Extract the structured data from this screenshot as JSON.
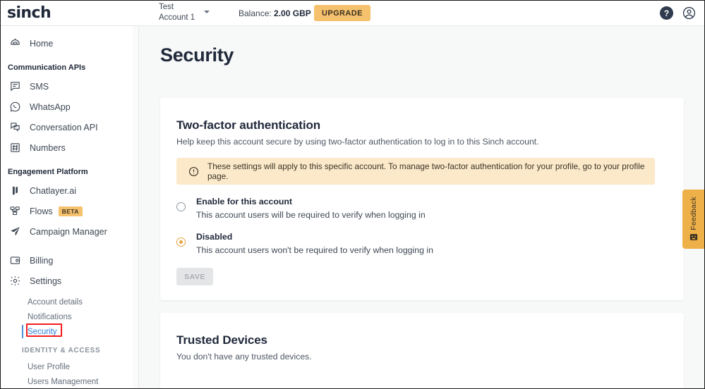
{
  "topbar": {
    "logo": "sinch",
    "account_name": "Test Account 1",
    "account_caret_icon": "chevron-down-icon",
    "balance_label": "Balance:",
    "balance_value": "2.00 GBP",
    "upgrade_label": "UPGRADE",
    "help_icon": "?",
    "help_icon_name": "help-circle-icon",
    "user_icon_name": "account-circle-icon"
  },
  "sidebar": {
    "home": {
      "label": "Home",
      "icon": "home-icon"
    },
    "groups": [
      {
        "title": "Communication APIs",
        "items": [
          {
            "label": "SMS",
            "icon": "sms-icon"
          },
          {
            "label": "WhatsApp",
            "icon": "whatsapp-icon"
          },
          {
            "label": "Conversation API",
            "icon": "conversation-icon"
          },
          {
            "label": "Numbers",
            "icon": "numbers-icon"
          }
        ]
      },
      {
        "title": "Engagement Platform",
        "items": [
          {
            "label": "Chatlayer.ai",
            "icon": "chatlayer-icon"
          },
          {
            "label": "Flows",
            "icon": "flows-icon",
            "badge": "BETA"
          },
          {
            "label": "Campaign Manager",
            "icon": "campaign-icon"
          }
        ]
      }
    ],
    "bottom_items": [
      {
        "label": "Billing",
        "icon": "billing-icon"
      },
      {
        "label": "Settings",
        "icon": "settings-gear-icon"
      }
    ],
    "settings_subitems": [
      {
        "label": "Account details",
        "active": false
      },
      {
        "label": "Notifications",
        "active": false
      },
      {
        "label": "Security",
        "active": true
      }
    ],
    "identity_group_title": "IDENTITY & ACCESS",
    "identity_subitems": [
      {
        "label": "User Profile"
      },
      {
        "label": "Users Management"
      }
    ]
  },
  "main": {
    "page_title": "Security",
    "two_factor": {
      "heading": "Two-factor authentication",
      "subheading": "Help keep this account secure by using two-factor authentication to log in to this Sinch account.",
      "notice_icon": "alert-circle-icon",
      "notice_text": "These settings will apply to this specific account. To manage two-factor authentication for your profile, go to your profile page.",
      "options": [
        {
          "title": "Enable for this account",
          "desc": "This account users will be required to verify when logging in",
          "selected": false
        },
        {
          "title": "Disabled",
          "desc": "This account users won't be required to verify when logging in",
          "selected": true
        }
      ],
      "save_label": "SAVE"
    },
    "trusted_devices": {
      "heading": "Trusted Devices",
      "subheading": "You don't have any trusted devices."
    }
  },
  "feedback": {
    "label": "Feedback",
    "icon": "feedback-smiley-icon"
  },
  "colors": {
    "accent_amber": "#f5c16c",
    "notice_bg": "#fbe9c9",
    "link_blue": "#2f7ed8",
    "annotation_red": "#f41c1c",
    "text_dark": "#20293a"
  }
}
